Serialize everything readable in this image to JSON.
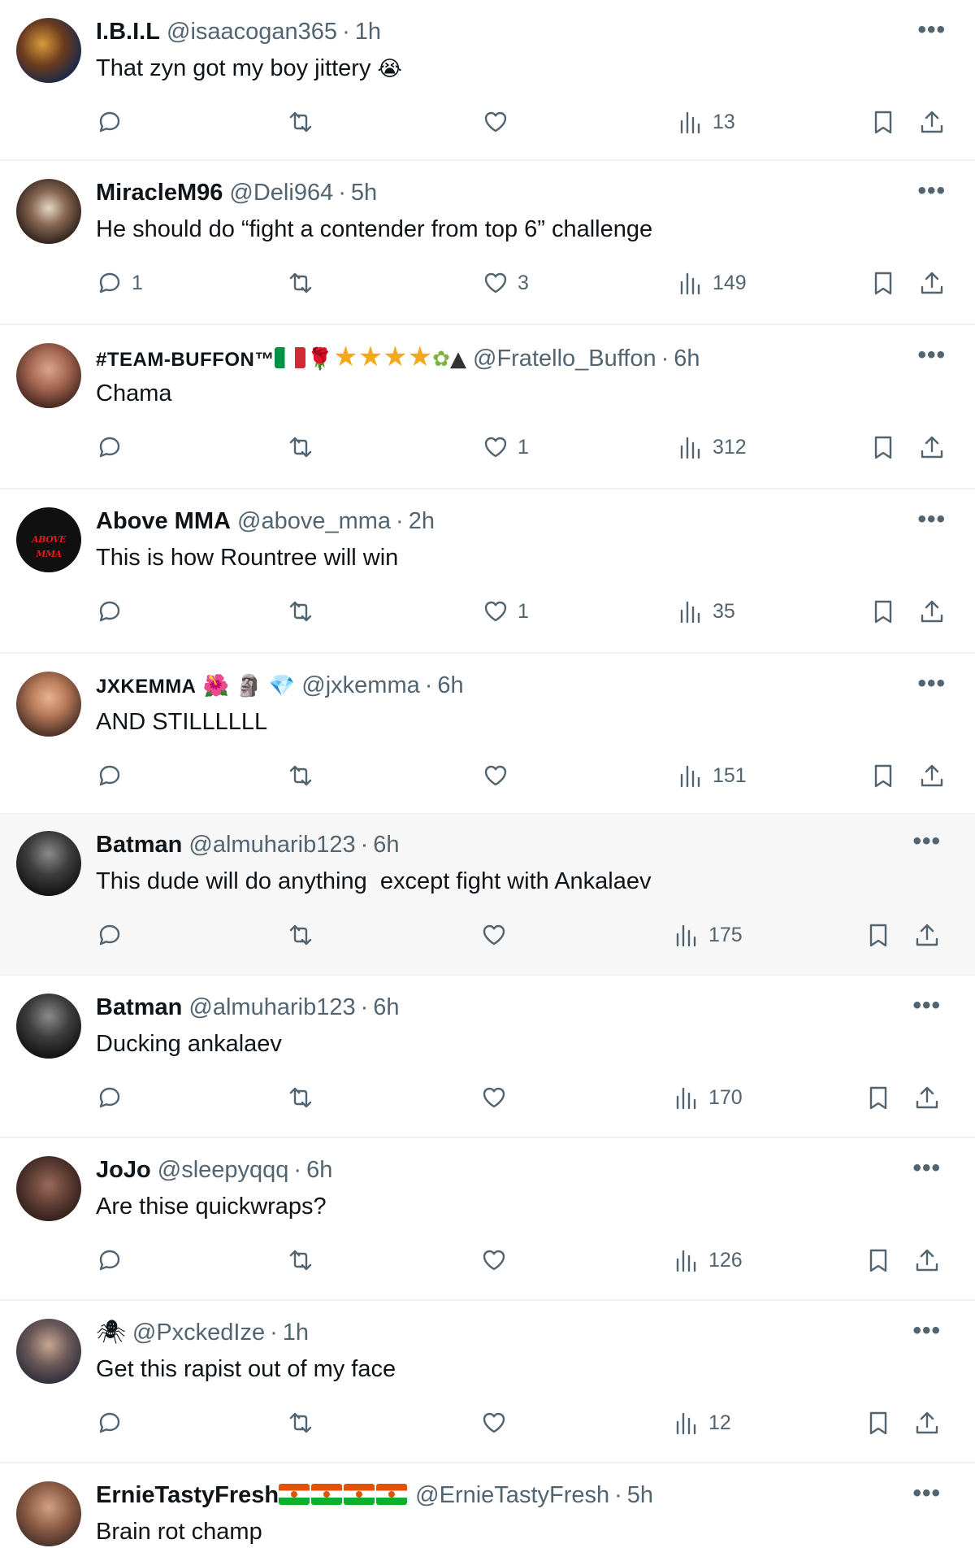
{
  "replies": [
    {
      "name": "I.B.I.L",
      "handle": "@isaacogan365",
      "time": "1h",
      "text": "That zyn got my boy jittery",
      "text_emoji": "😭",
      "reply_count": "",
      "retweet_count": "",
      "like_count": "",
      "views": "13"
    },
    {
      "name": "MiracleM96",
      "handle": "@Deli964",
      "time": "5h",
      "text": "He should do “fight a contender from top 6” challenge",
      "reply_count": "1",
      "retweet_count": "",
      "like_count": "3",
      "views": "149"
    },
    {
      "name": "#TEAM-BUFFON™",
      "name_emojis": "🌹",
      "handle": "@Fratello_Buffon",
      "time": "6h",
      "text": "Chama",
      "reply_count": "",
      "retweet_count": "",
      "like_count": "1",
      "views": "312"
    },
    {
      "name": "Above MMA",
      "avatar_text": "ABOVE MMA",
      "handle": "@above_mma",
      "time": "2h",
      "text": "This is how Rountree will win",
      "reply_count": "",
      "retweet_count": "",
      "like_count": "1",
      "views": "35"
    },
    {
      "name": "JXKEMMA",
      "name_emojis": "🌺 🗿 💎",
      "handle": "@jxkemma",
      "time": "6h",
      "text": "AND STILLLLLL",
      "reply_count": "",
      "retweet_count": "",
      "like_count": "",
      "views": "151"
    },
    {
      "name": "Batman",
      "handle": "@almuharib123",
      "time": "6h",
      "text": "This dude will do anything  except fight with Ankalaev",
      "reply_count": "",
      "retweet_count": "",
      "like_count": "",
      "views": "175"
    },
    {
      "name": "Batman",
      "handle": "@almuharib123",
      "time": "6h",
      "text": "Ducking ankalaev",
      "reply_count": "",
      "retweet_count": "",
      "like_count": "",
      "views": "170"
    },
    {
      "name": "JoJo",
      "handle": "@sleepyqqq",
      "time": "6h",
      "text": "Are thise quickwraps?",
      "reply_count": "",
      "retweet_count": "",
      "like_count": "",
      "views": "126"
    },
    {
      "name": "🕷",
      "handle": "@PxckedIze",
      "time": "1h",
      "text": "Get this rapist out of my face",
      "reply_count": "",
      "retweet_count": "",
      "like_count": "",
      "views": "12"
    },
    {
      "name": "ErnieTastyFresh",
      "handle": "@ErnieTastyFresh",
      "time": "5h",
      "text": "Brain rot champ"
    }
  ],
  "separator": "·",
  "more_label": "•••",
  "colors": {
    "text": "#0f1419",
    "secondary": "#536471",
    "divider": "#eff3f4",
    "highlight_bg": "#f7f7f7",
    "star": "#f4a81d"
  }
}
